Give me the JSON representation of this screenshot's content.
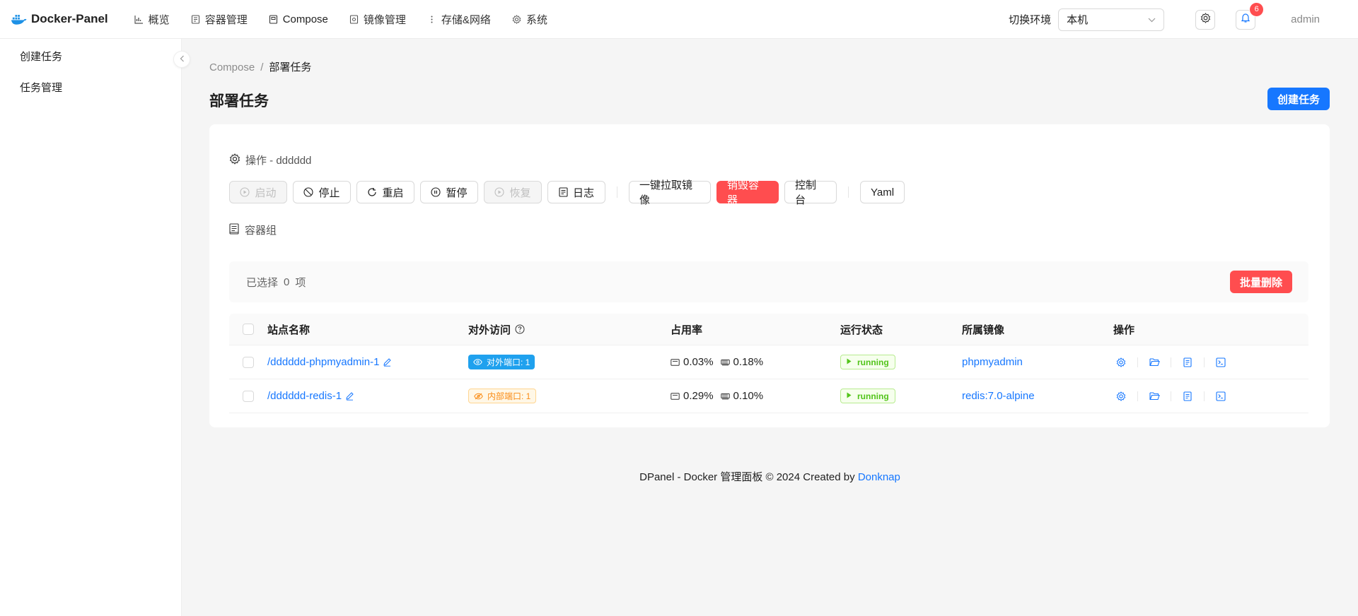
{
  "app": {
    "name": "Docker-Panel"
  },
  "nav": {
    "items": [
      {
        "label": "概览",
        "icon": "chart-icon"
      },
      {
        "label": "容器管理",
        "icon": "container-icon"
      },
      {
        "label": "Compose",
        "icon": "compose-icon"
      },
      {
        "label": "镜像管理",
        "icon": "image-icon"
      },
      {
        "label": "存储&网络",
        "icon": "more-icon"
      },
      {
        "label": "系统",
        "icon": "gear-icon"
      }
    ],
    "active": "Compose"
  },
  "header": {
    "env_label": "切换环境",
    "env_value": "本机",
    "notification_count": "6",
    "user": "admin"
  },
  "sidebar": {
    "items": [
      {
        "label": "创建任务"
      },
      {
        "label": "任务管理"
      }
    ]
  },
  "breadcrumb": {
    "root": "Compose",
    "separator": "/",
    "current": "部署任务"
  },
  "page": {
    "title": "部署任务",
    "create_button": "创建任务"
  },
  "operations": {
    "title": "操作 - dddddd",
    "buttons": [
      {
        "label": "启动",
        "state": "disabled"
      },
      {
        "label": "停止",
        "state": "normal"
      },
      {
        "label": "重启",
        "state": "normal"
      },
      {
        "label": "暂停",
        "state": "normal"
      },
      {
        "label": "恢复",
        "state": "disabled"
      },
      {
        "label": "日志",
        "state": "normal"
      }
    ],
    "pull_button": "一键拉取镜像",
    "destroy_button": "销毁容器",
    "console_button": "控制台",
    "yaml_button": "Yaml"
  },
  "group": {
    "title": "容器组",
    "selected_prefix": "已选择",
    "selected_count": "0",
    "selected_suffix": "项",
    "bulk_delete": "批量删除"
  },
  "table": {
    "headers": [
      "站点名称",
      "对外访问",
      "占用率",
      "运行状态",
      "所属镜像",
      "操作"
    ],
    "rows": [
      {
        "name": "/dddddd-phpmyadmin-1",
        "access": "对外端口: 1",
        "access_type": "external",
        "cpu": "0.03%",
        "mem": "0.18%",
        "status": "running",
        "image": "phpmyadmin"
      },
      {
        "name": "/dddddd-redis-1",
        "access": "内部端口: 1",
        "access_type": "internal",
        "cpu": "0.29%",
        "mem": "0.10%",
        "status": "running",
        "image": "redis:7.0-alpine"
      }
    ]
  },
  "footer": {
    "text": "DPanel - Docker 管理面板 © 2024 Created by",
    "link": "Donknap"
  },
  "colors": {
    "primary": "#1677ff",
    "danger": "#ff4d4f",
    "success": "#52c41a",
    "warning": "#fa8c16",
    "info": "#1fa1ee"
  }
}
